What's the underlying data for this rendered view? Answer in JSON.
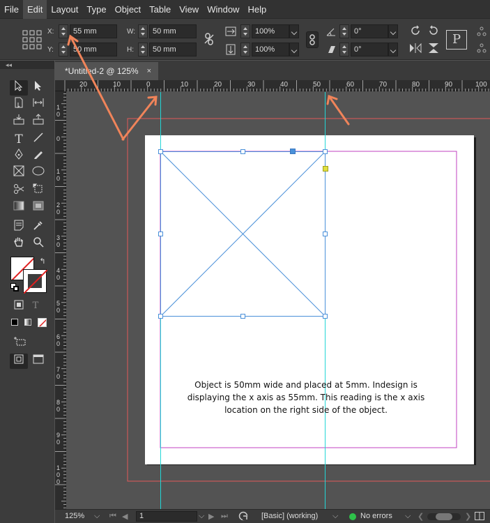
{
  "menubar": {
    "items": [
      "File",
      "Edit",
      "Layout",
      "Type",
      "Object",
      "Table",
      "View",
      "Window",
      "Help"
    ],
    "active": "Edit"
  },
  "control": {
    "x_label": "X:",
    "x_value": "55 mm",
    "y_label": "Y:",
    "y_value": "50 mm",
    "w_label": "W:",
    "w_value": "50 mm",
    "h_label": "H:",
    "h_value": "50 mm",
    "scale_x_value": "100%",
    "scale_y_value": "100%",
    "rotate_value": "0°",
    "shear_value": "0°"
  },
  "tab": {
    "title": "*Untitled-2 @ 125%",
    "close": "×"
  },
  "ruler": {
    "h_labels": [
      "20",
      "10",
      "0",
      "10",
      "20",
      "30",
      "40",
      "50",
      "60",
      "70",
      "80",
      "90",
      "100"
    ],
    "v_labels": [
      "10",
      "0",
      "10",
      "20",
      "30",
      "40",
      "50",
      "60",
      "70",
      "80",
      "90",
      "100",
      "110"
    ]
  },
  "canvas": {
    "annotation_lines": [
      "Object is 50mm wide and placed at 5mm. Indesign is",
      "displaying the x axis as 55mm. This reading is the x axis",
      "location on the right side of the object."
    ],
    "colors": {
      "bleed": "#e05a5a",
      "margin": "#c040c0",
      "guide": "#22d6d6",
      "frame": "#4a90d9",
      "arrow": "#f0845a"
    }
  },
  "status": {
    "zoom": "125%",
    "page": "1",
    "style": "[Basic] (working)",
    "errors": "No errors"
  }
}
